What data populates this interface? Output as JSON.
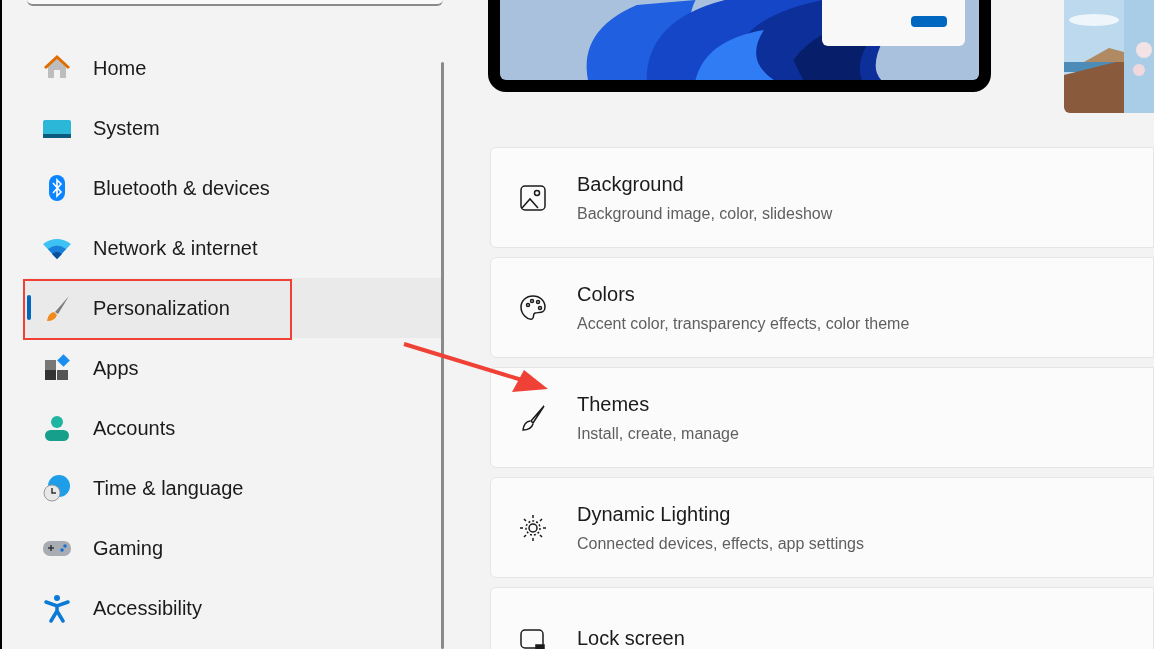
{
  "sidebar": {
    "items": [
      {
        "label": "Home",
        "kind": "home",
        "selected": false
      },
      {
        "label": "System",
        "kind": "system",
        "selected": false
      },
      {
        "label": "Bluetooth & devices",
        "kind": "bluetooth",
        "selected": false
      },
      {
        "label": "Network & internet",
        "kind": "network",
        "selected": false
      },
      {
        "label": "Personalization",
        "kind": "personalization",
        "selected": true
      },
      {
        "label": "Apps",
        "kind": "apps",
        "selected": false
      },
      {
        "label": "Accounts",
        "kind": "accounts",
        "selected": false
      },
      {
        "label": "Time & language",
        "kind": "time",
        "selected": false
      },
      {
        "label": "Gaming",
        "kind": "gaming",
        "selected": false
      },
      {
        "label": "Accessibility",
        "kind": "accessibility",
        "selected": false
      }
    ]
  },
  "settings": [
    {
      "kind": "background",
      "title": "Background",
      "subtitle": "Background image, color, slideshow"
    },
    {
      "kind": "colors",
      "title": "Colors",
      "subtitle": "Accent color, transparency effects, color theme"
    },
    {
      "kind": "themes",
      "title": "Themes",
      "subtitle": "Install, create, manage"
    },
    {
      "kind": "lighting",
      "title": "Dynamic Lighting",
      "subtitle": "Connected devices, effects, app settings"
    },
    {
      "kind": "lock",
      "title": "Lock screen"
    }
  ]
}
